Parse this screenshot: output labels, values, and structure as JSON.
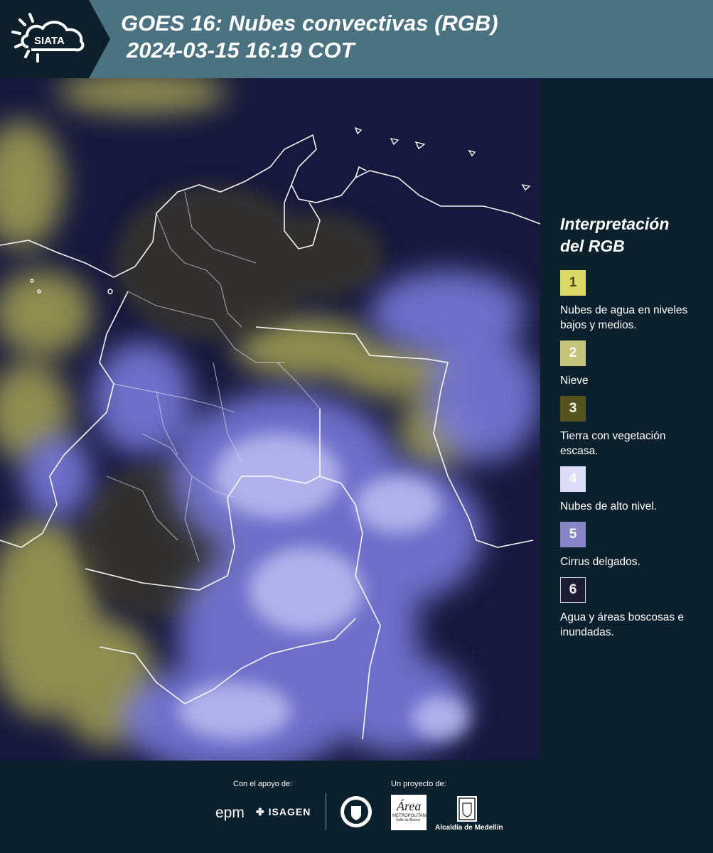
{
  "header": {
    "logo_text": "SIATA",
    "title_line1": "GOES 16: Nubes convectivas (RGB)",
    "title_line2": "2024-03-15 16:19 COT"
  },
  "legend": {
    "title_line1": "Interpretación",
    "title_line2": "del RGB",
    "items": [
      {
        "num": "1",
        "label": "Nubes de agua en niveles bajos y medios.",
        "color": "#dcd867",
        "text_color": "#4a4a2a"
      },
      {
        "num": "2",
        "label": "Nieve",
        "color": "#c8c37c",
        "text_color": "#ffffff"
      },
      {
        "num": "3",
        "label": "Tierra con vegetación escasa.",
        "color": "#56531f",
        "text_color": "#ffffff"
      },
      {
        "num": "4",
        "label": "Nubes de alto nivel.",
        "color": "#dcdcf6",
        "text_color": "#ffffff"
      },
      {
        "num": "5",
        "label": "Cirrus delgados.",
        "color": "#8886c8",
        "text_color": "#ffffff"
      },
      {
        "num": "6",
        "label": "Agua y áreas boscosas e inundadas.",
        "color": "#1d1a33",
        "text_color": "#ffffff"
      }
    ]
  },
  "footer": {
    "support_label": "Con el apoyo de:",
    "project_label": "Un proyecto de:",
    "epm": "epm",
    "isagen": "ISAGEN",
    "metro_name": "Área",
    "metro_sub": "METROPOLITANA",
    "metro_sub2": "Valle de Aburrá",
    "alcaldia": "Alcaldía de Medellín"
  }
}
